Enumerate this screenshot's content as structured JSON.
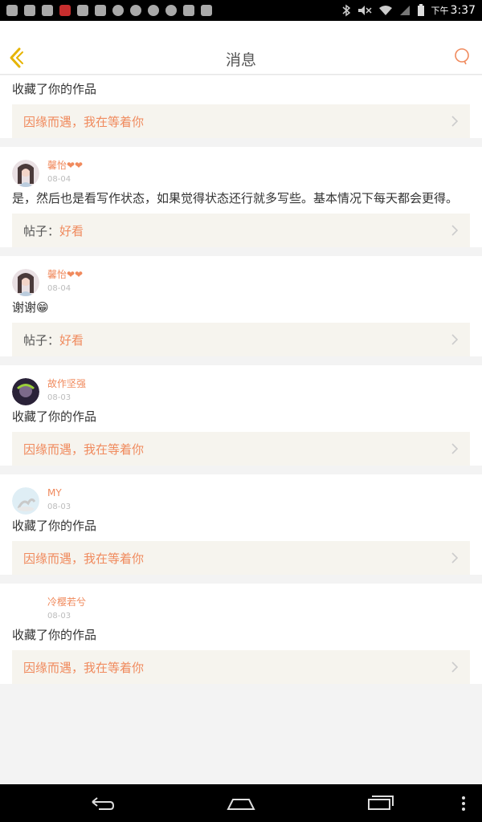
{
  "status_bar": {
    "time_prefix": "下午",
    "time": "3:37"
  },
  "header": {
    "title": "消息"
  },
  "messages": [
    {
      "message": "收藏了你的作品",
      "ref_prefix": "",
      "ref_value": "因缘而遇，我在等着你"
    },
    {
      "user": "馨怡❤❤",
      "date": "08-04",
      "message": "是，然后也是看写作状态，如果觉得状态还行就多写些。基本情况下每天都会更得。",
      "ref_prefix": "帖子：",
      "ref_value": "好看"
    },
    {
      "user": "馨怡❤❤",
      "date": "08-04",
      "message": "谢谢😁",
      "ref_prefix": "帖子：",
      "ref_value": "好看"
    },
    {
      "user": "故作坚强",
      "date": "08-03",
      "message": "收藏了你的作品",
      "ref_prefix": "",
      "ref_value": "因缘而遇，我在等着你"
    },
    {
      "user": "MY",
      "date": "08-03",
      "message": "收藏了你的作品",
      "ref_prefix": "",
      "ref_value": "因缘而遇，我在等着你"
    },
    {
      "user": "冷樱若兮",
      "date": "08-03",
      "message": "收藏了你的作品",
      "ref_prefix": "",
      "ref_value": "因缘而遇，我在等着你"
    }
  ],
  "colors": {
    "accent": "#f08a5d",
    "ref_bg": "#f6f4ee"
  }
}
